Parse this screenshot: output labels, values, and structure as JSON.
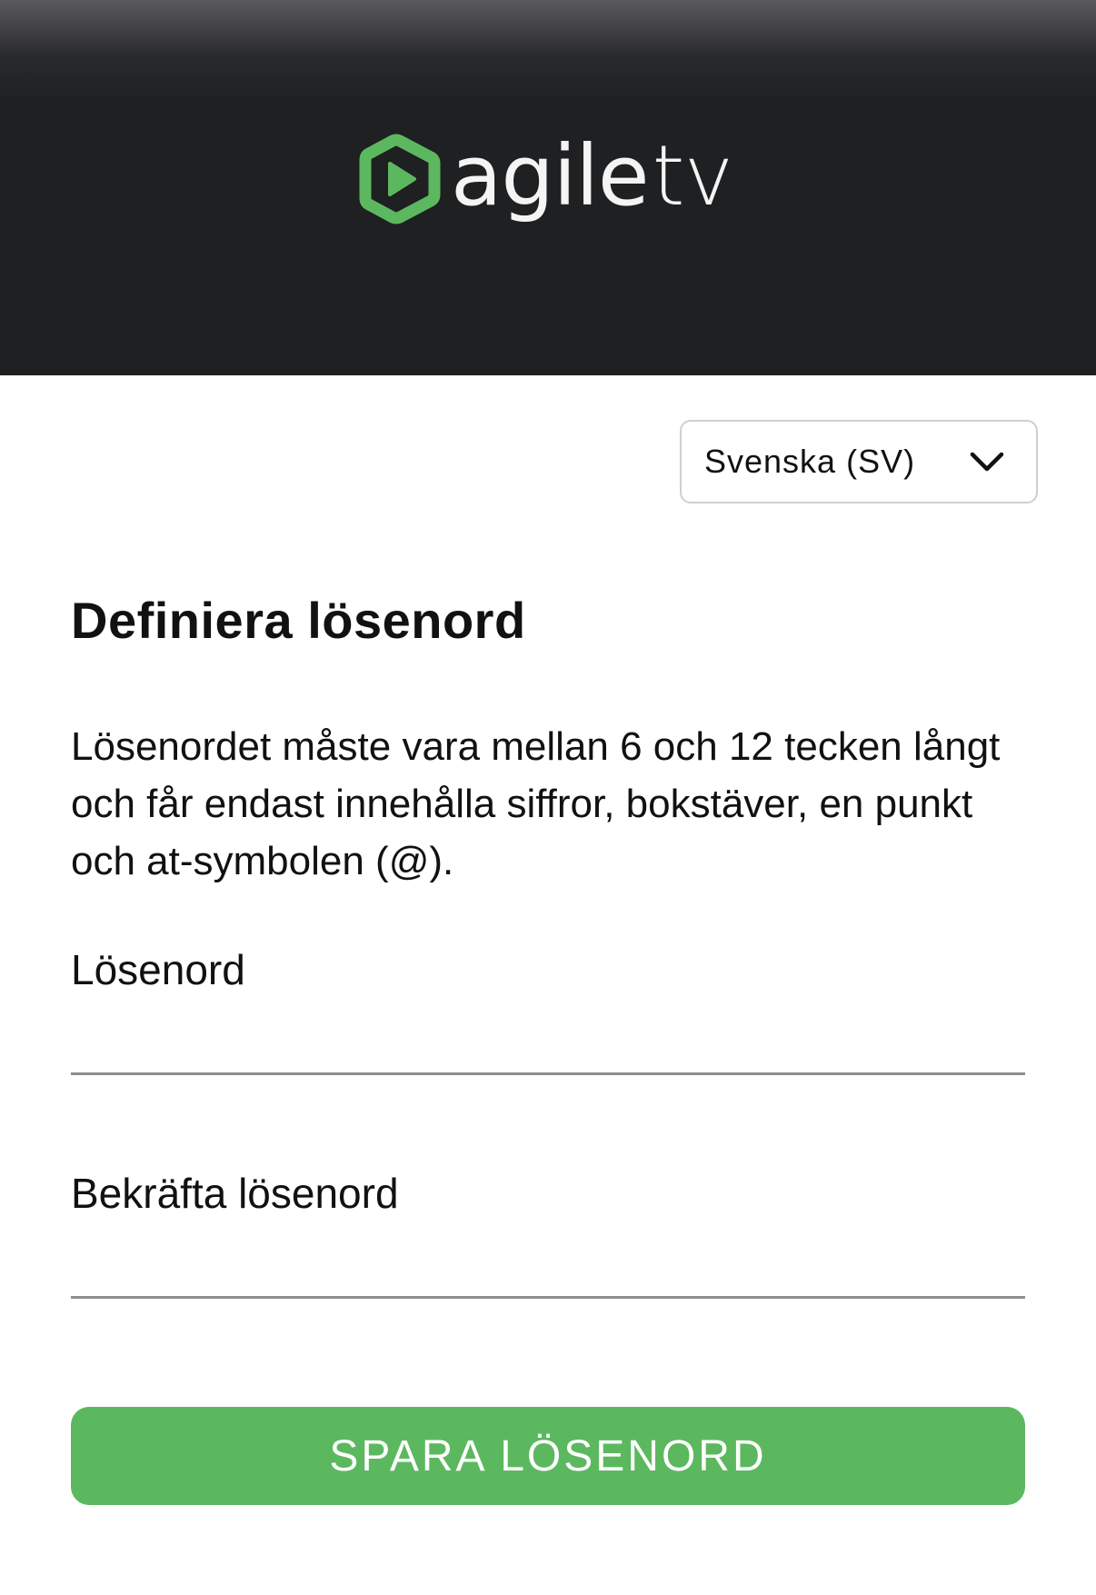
{
  "header": {
    "logo_text_agile": "agile",
    "logo_text_tv": "tv",
    "logo_icon": "play-hexagon-icon",
    "accent_color": "#5cb85f"
  },
  "language": {
    "selected": "Svenska (SV)",
    "icon": "chevron-down-icon"
  },
  "form": {
    "title": "Definiera lösenord",
    "description": "Lösenordet måste vara mellan 6 och 12 tecken långt och får endast innehålla siffror, bokstäver, en punkt och at-symbolen (@).",
    "password_label": "Lösenord",
    "password_value": "",
    "confirm_label": "Bekräfta lösenord",
    "confirm_value": "",
    "save_label": "SPARA LÖSENORD"
  }
}
